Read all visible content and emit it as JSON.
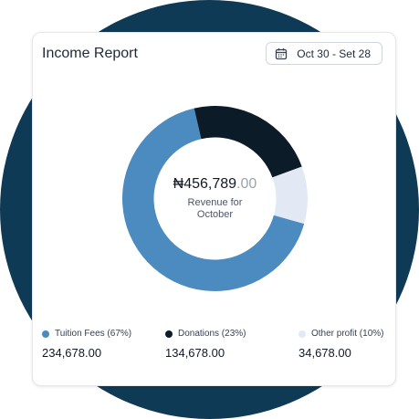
{
  "header": {
    "title": "Income Report",
    "date_range": "Oct 30 - Set 28"
  },
  "summary": {
    "amount_main": "₦456,789",
    "amount_cents": ".00",
    "caption": "Revenue for October"
  },
  "chart_data": {
    "type": "pie",
    "categories": [
      "Tuition Fees",
      "Donations",
      "Other profit"
    ],
    "values": [
      67,
      23,
      10
    ],
    "colors": [
      "#4b8bc0",
      "#0b1b27",
      "#e3e8f5"
    ]
  },
  "legend": [
    {
      "label": "Tuition Fees (67%)",
      "value": "234,678.00",
      "color": "#4b8bc0"
    },
    {
      "label": "Donations (23%)",
      "value": "134,678.00",
      "color": "#0b1b27"
    },
    {
      "label": "Other profit (10%)",
      "value": "34,678.00",
      "color": "#e3e8f5"
    }
  ],
  "icons": {
    "date": "calendar-icon"
  }
}
